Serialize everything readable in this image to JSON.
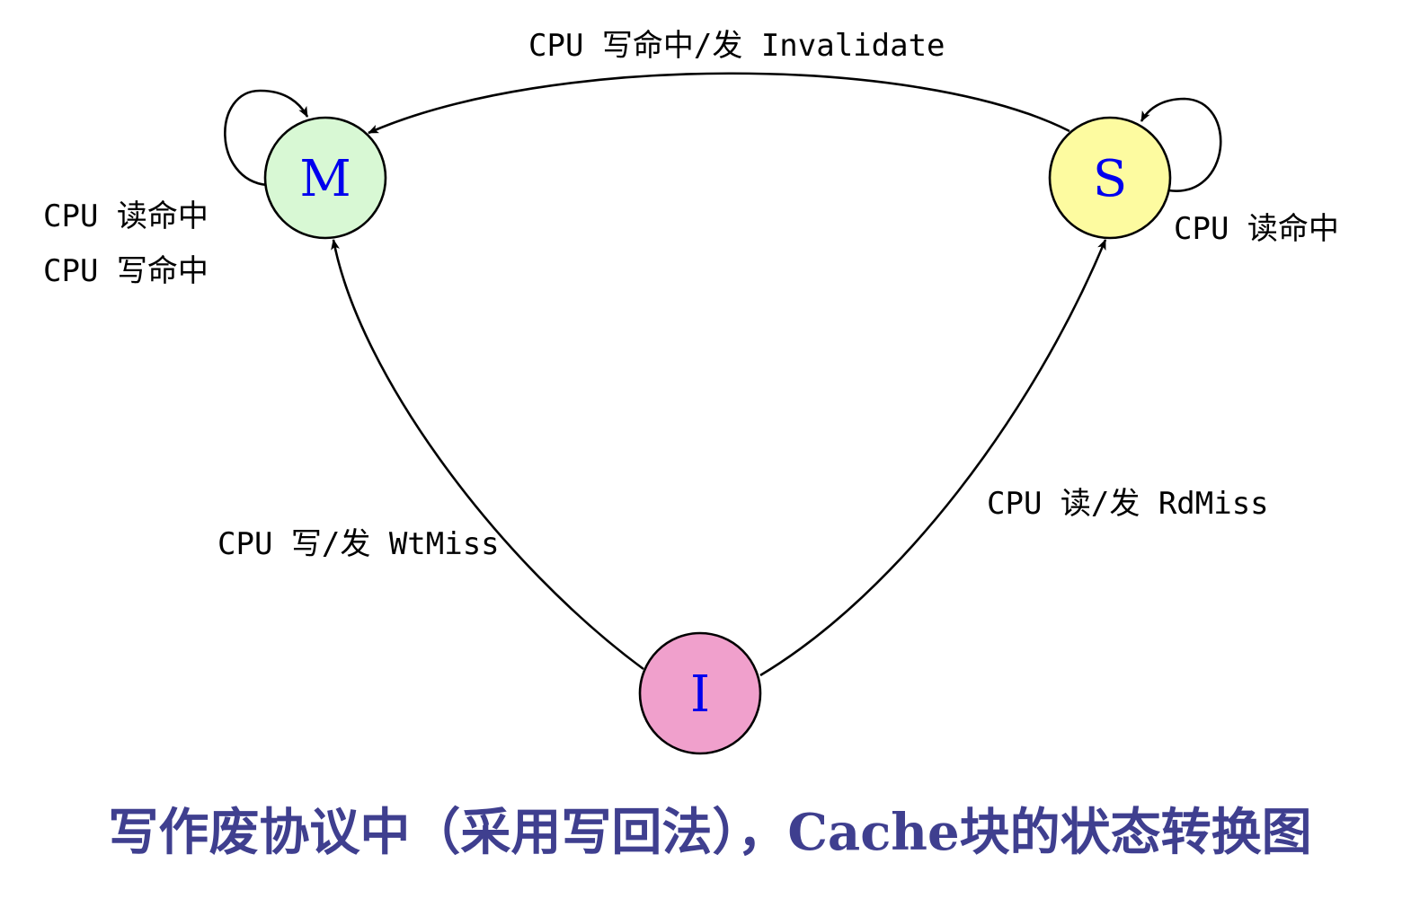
{
  "nodes": {
    "m": {
      "label": "M",
      "fill": "#d8f8d4"
    },
    "s": {
      "label": "S",
      "fill": "#fdfba0"
    },
    "i": {
      "label": "I",
      "fill": "#f0a0cc"
    }
  },
  "edges": {
    "s_to_m": "CPU 写命中/发 Invalidate",
    "m_self_read": "CPU 读命中",
    "m_self_write": "CPU 写命中",
    "s_self_read": "CPU 读命中",
    "i_to_m": "CPU 写/发 WtMiss",
    "i_to_s": "CPU 读/发 RdMiss"
  },
  "caption": "写作废协议中（采用写回法），Cache块的状态转换图",
  "colors": {
    "node_label": "#0000ee",
    "caption": "#3f3f8f",
    "edge": "#000000"
  }
}
